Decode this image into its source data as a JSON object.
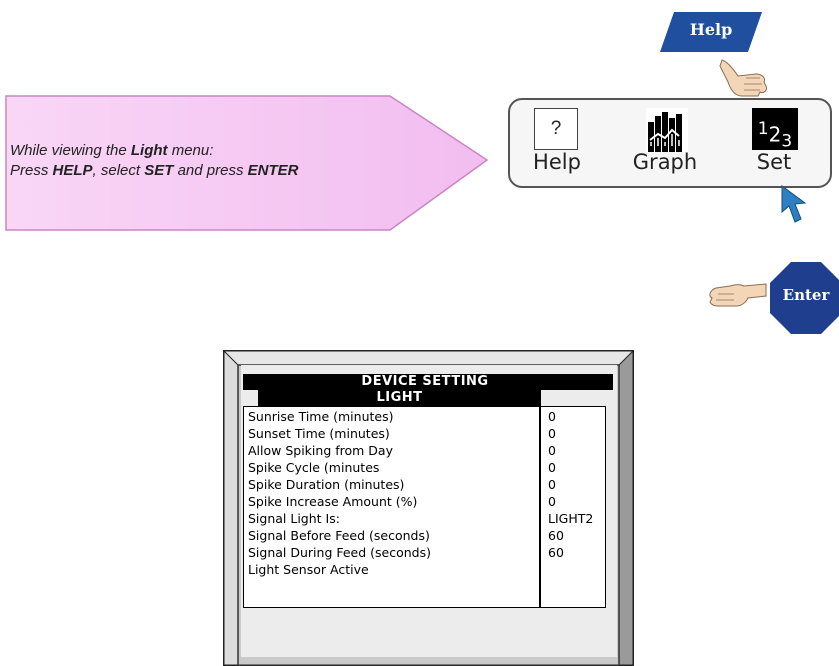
{
  "instruction": {
    "line1_pre": "While viewing the ",
    "line1_bold": "Light",
    "line1_post": " menu:",
    "line2_a": "Press ",
    "line2_b": "HELP",
    "line2_c": ", select ",
    "line2_d": "SET",
    "line2_e": " and press ",
    "line2_f": "ENTER"
  },
  "help_flag": {
    "label": "Help",
    "color": "#1f4f9e"
  },
  "keys": {
    "help": {
      "symbol": "?",
      "label": "Help"
    },
    "graph": {
      "label": "Graph"
    },
    "set": {
      "label": "Set",
      "symbol_1": "1",
      "symbol_2": "2",
      "symbol_3": "3"
    }
  },
  "enter_sign": {
    "label": "Enter",
    "color": "#1f3f8e"
  },
  "device": {
    "title": "DEVICE SETTING",
    "subtitle": "LIGHT",
    "rows": [
      {
        "label": "Sunrise Time (minutes)",
        "value": "0"
      },
      {
        "label": "Sunset Time (minutes)",
        "value": "0"
      },
      {
        "label": "Allow Spiking from Day",
        "value": "0"
      },
      {
        "label": "Spike Cycle (minutes",
        "value": "0"
      },
      {
        "label": "Spike Duration (minutes)",
        "value": "0"
      },
      {
        "label": "Spike Increase Amount (%)",
        "value": "0"
      },
      {
        "label": "Signal Light Is:",
        "value": "LIGHT2"
      },
      {
        "label": "Signal Before Feed (seconds)",
        "value": "60"
      },
      {
        "label": "Signal During Feed (seconds)",
        "value": "60"
      },
      {
        "label": "Light Sensor Active",
        "value": ""
      }
    ]
  },
  "colors": {
    "callout_fill": "#f6c8f4",
    "callout_border": "#c986c4",
    "cursor": "#2d7fc1"
  }
}
